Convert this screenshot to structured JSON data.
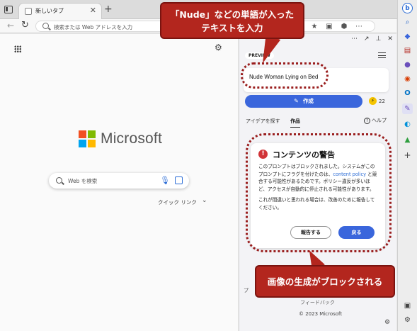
{
  "browser": {
    "tab_title": "新しいタブ",
    "tab_close": "✕",
    "new_tab": "+",
    "address_placeholder": "検索または Web アドレスを入力"
  },
  "newtab": {
    "brand": "Microsoft",
    "logo_colors": [
      "#f25022",
      "#7fba00",
      "#00a4ef",
      "#ffb900"
    ],
    "search_placeholder": "Web を検索",
    "quick_links": "クイック リンク"
  },
  "panel": {
    "preview_badge": "PREVIEW",
    "prompt": "Nude Woman Lying on Bed",
    "create_button": "作成",
    "boost_count": "22",
    "tabs": {
      "ideas": "アイデアを探す",
      "creations": "作品"
    },
    "help": "ヘルプ",
    "warning": {
      "title": "コンテンツの警告",
      "body_part1": "このプロンプトはブロックされました。システムがこのプロンプトにフラグを付けたのは、",
      "policy_link": "content policy",
      "body_part2": " と競合する可能性があるためです。ポリシー違反が多いほど、アクセスが自動的に停止される可能性があります。",
      "body_para2": "これが間違いと思われる場合は、改善のために報告してください。",
      "report_button": "報告する",
      "back_button": "戻る"
    },
    "footer_stub": "プ",
    "feedback": "フィードバック",
    "copyright": "© 2023 Microsoft"
  },
  "annotations": {
    "top_line1": "「Nude」などの単語が入った",
    "top_line2": "テキストを入力",
    "bottom": "画像の生成がブロックされる",
    "accent_color": "#b3261e"
  },
  "icons": {
    "edge_sidebar": [
      "bing-icon",
      "search-icon",
      "tag-icon",
      "briefcase-icon",
      "user-icon",
      "office-icon",
      "outlook-icon",
      "image-creator-icon",
      "drop-icon",
      "tree-icon",
      "plus-icon"
    ]
  }
}
